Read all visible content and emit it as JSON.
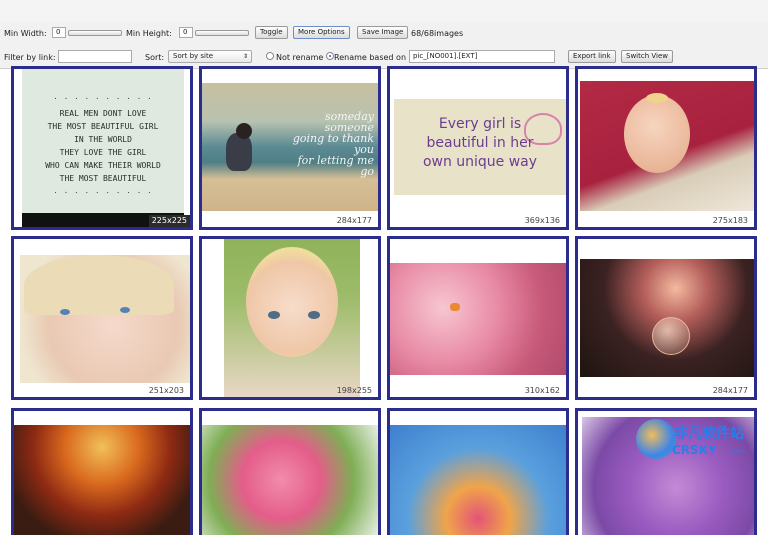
{
  "toolbar": {
    "min_width_label": "Min Width:",
    "min_width_value": "0",
    "min_height_label": "Min Height:",
    "min_height_value": "0",
    "toggle_label": "Toggle",
    "more_options_label": "More Options",
    "save_image_label": "Save Image",
    "image_count": "68/68images",
    "filter_label": "Filter by link:",
    "filter_value": "",
    "sort_label": "Sort:",
    "sort_selected": "Sort by site",
    "not_rename_label": "Not rename",
    "rename_label": "Rename based on",
    "rename_pattern": "pic_[NO001].[EXT]",
    "export_label": "Export link",
    "switch_view_label": "Switch View"
  },
  "gallery": {
    "tiles": [
      {
        "dim": "225x225",
        "quote_lines": [
          "REAL MEN DONT LOVE",
          "THE MOST BEAUTIFUL GIRL",
          "IN THE WORLD",
          "THEY LOVE THE GIRL",
          "WHO CAN MAKE THEIR WORLD",
          "THE MOST BEAUTIFUL"
        ]
      },
      {
        "dim": "284x177",
        "script_lines": [
          "someday",
          "someone",
          "going to thank you",
          "for letting me go"
        ]
      },
      {
        "dim": "369x136",
        "lines": [
          "Every girl is",
          "beautiful in her",
          "own unique way"
        ]
      },
      {
        "dim": "275x183"
      },
      {
        "dim": "251x203"
      },
      {
        "dim": "198x255"
      },
      {
        "dim": "310x162"
      },
      {
        "dim": "284x177"
      },
      {
        "dim": ""
      },
      {
        "dim": ""
      },
      {
        "dim": ""
      },
      {
        "dim": ""
      }
    ]
  },
  "watermark": {
    "cn": "非凡软件站",
    "en": "CRSKY",
    "suffix": ".com"
  }
}
